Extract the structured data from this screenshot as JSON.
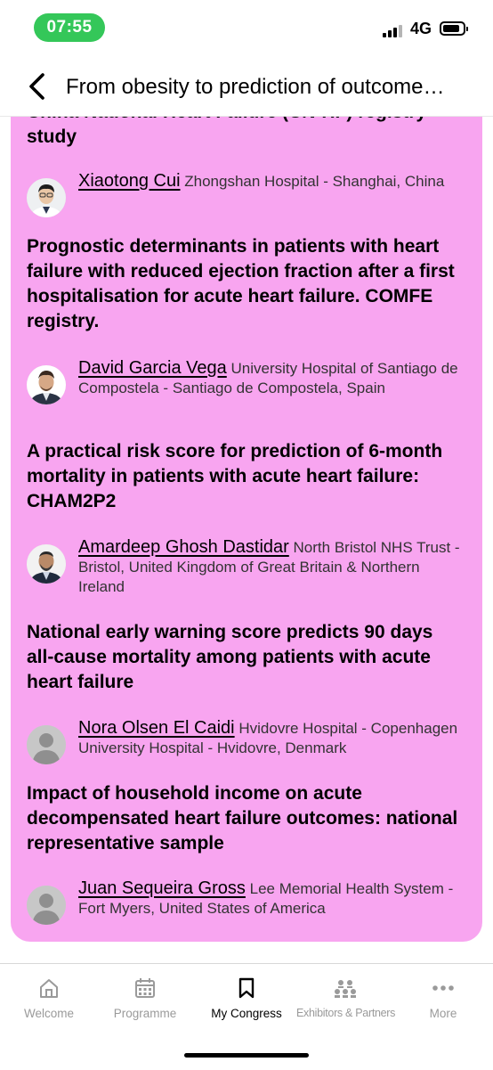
{
  "status_bar": {
    "time": "07:55",
    "network": "4G",
    "battery_level": 0.85
  },
  "header": {
    "title": "From obesity to prediction of outcome…"
  },
  "session": {
    "partial_title": "China National Heart Failure (CN-HF) registry study",
    "talks": [
      {
        "speaker_name": "Xiaotong Cui",
        "affiliation": "Zhongshan Hospital - Shanghai, China"
      },
      {
        "title": "Prognostic determinants in patients with heart failure with reduced ejection fraction after a first hospitalisation for acute heart failure. COMFE registry.",
        "speaker_name": "David Garcia Vega",
        "affiliation": "University Hospital of Santiago de Compostela - Santiago de Compostela, Spain"
      },
      {
        "title": "A practical risk score for prediction of 6-month mortality in patients with acute heart failure: CHAM2P2",
        "speaker_name": "Amardeep Ghosh Dastidar",
        "affiliation": "North Bristol NHS Trust - Bristol, United Kingdom of Great Britain & Northern Ireland"
      },
      {
        "title": "National early warning score predicts 90 days all-cause mortality among patients with acute heart failure",
        "speaker_name": "Nora Olsen El Caidi",
        "affiliation": "Hvidovre Hospital - Copenhagen University Hospital - Hvidovre, Denmark"
      },
      {
        "title": "Impact of household income on acute decompensated heart failure outcomes: national representative sample",
        "speaker_name": "Juan Sequeira Gross",
        "affiliation": "Lee Memorial Health System - Fort Myers, United States of America"
      }
    ]
  },
  "tabs": [
    {
      "label": "Welcome",
      "icon": "home-icon"
    },
    {
      "label": "Programme",
      "icon": "calendar-icon"
    },
    {
      "label": "My Congress",
      "icon": "bookmark-icon"
    },
    {
      "label": "Exhibitors & Partners",
      "icon": "network-icon"
    },
    {
      "label": "More",
      "icon": "more-icon"
    }
  ],
  "colors": {
    "card": "#f8a5f0",
    "time_pill": "#34c759",
    "active_tab": "#000000",
    "inactive_tab": "#9a9a9a"
  }
}
